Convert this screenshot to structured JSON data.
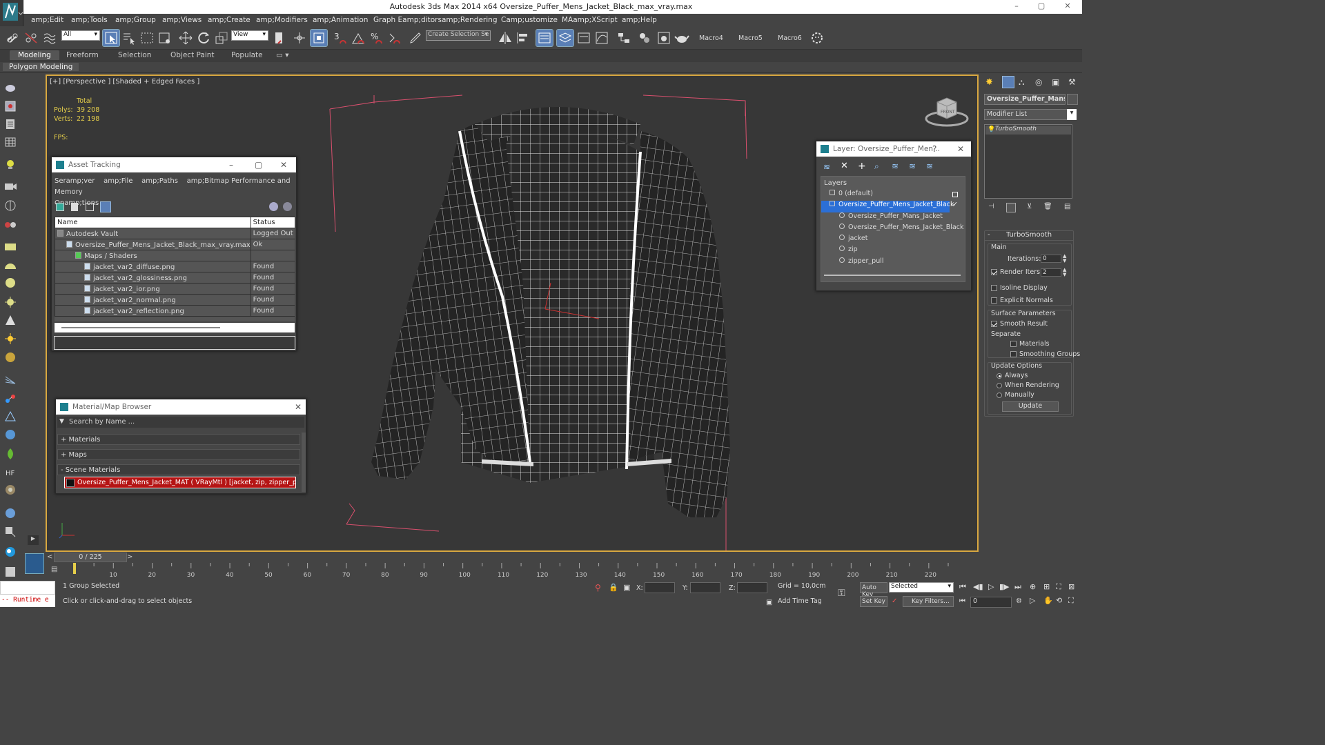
{
  "title_bar": {
    "title": "Autodesk 3ds Max  2014 x64      Oversize_Puffer_Mens_Jacket_Black_max_vray.max",
    "minimize": "–",
    "maximize": "▢",
    "close": "✕"
  },
  "menu": [
    "amp;Edit",
    "amp;Tools",
    "amp;Group",
    "amp;Views",
    "amp;Create",
    "amp;Modifiers",
    "amp;Animation",
    "Graph Eamp;ditors",
    "amp;Rendering",
    "Camp;ustomize",
    "MAamp;XScript",
    "amp;Help"
  ],
  "toolbar": {
    "selection_filter": "All",
    "ref_coord": "View",
    "named_selection_placeholder": "Create Selection Se",
    "snap_3": "3",
    "macros": [
      "Macro4",
      "Macro5",
      "Macro6"
    ]
  },
  "ribbon": {
    "tabs": [
      "Modeling",
      "Freeform",
      "Selection",
      "Object Paint",
      "Populate"
    ],
    "active_tab": "Modeling",
    "sub_panel": "Polygon Modeling"
  },
  "viewport": {
    "label": "[+] [Perspective ] [Shaded + Edged Faces ]",
    "stats": {
      "total_label": "Total",
      "polys_label": "Polys:",
      "polys_value": "39 208",
      "verts_label": "Verts:",
      "verts_value": "22 198",
      "fps_label": "FPS:"
    },
    "viewcube_label": "FRONT"
  },
  "asset_tracking": {
    "title": "Asset Tracking",
    "menu": [
      "Seramp;ver",
      "amp;File",
      "amp;Paths",
      "amp;Bitmap Performance and Memory"
    ],
    "menu2": "Opamp;tions",
    "columns": [
      "Name",
      "Status"
    ],
    "rows": [
      {
        "name": "Autodesk Vault",
        "status": "Logged Out ...",
        "indent": 1
      },
      {
        "name": "Oversize_Puffer_Mens_Jacket_Black_max_vray.max",
        "status": "Ok",
        "indent": 2
      },
      {
        "name": "Maps / Shaders",
        "status": "",
        "indent": 3
      },
      {
        "name": "jacket_var2_diffuse.png",
        "status": "Found",
        "indent": 4
      },
      {
        "name": "jacket_var2_glossiness.png",
        "status": "Found",
        "indent": 4
      },
      {
        "name": "jacket_var2_ior.png",
        "status": "Found",
        "indent": 4
      },
      {
        "name": "jacket_var2_normal.png",
        "status": "Found",
        "indent": 4
      },
      {
        "name": "jacket_var2_reflection.png",
        "status": "Found",
        "indent": 4
      }
    ]
  },
  "material_browser": {
    "title": "Material/Map Browser",
    "search_placeholder": "Search by Name ...",
    "sections": [
      "+ Materials",
      "+ Maps",
      "- Scene Materials"
    ],
    "scene_material": "Oversize_Puffer_Mens_Jacket_MAT  ( VRayMtl )  [jacket, zip, zipper_pull]"
  },
  "layer_dialog": {
    "title": "Layer: Oversize_Puffer_Men...",
    "help": "?",
    "header": "Layers",
    "items": [
      {
        "name": "0 (default)",
        "level": 0,
        "selected": false
      },
      {
        "name": "Oversize_Puffer_Mens_Jacket_Black",
        "level": 0,
        "selected": true
      },
      {
        "name": "Oversize_Puffer_Mans_Jacket",
        "level": 1,
        "selected": false
      },
      {
        "name": "Oversize_Puffer_Mens_Jacket_Black",
        "level": 1,
        "selected": false
      },
      {
        "name": "jacket",
        "level": 1,
        "selected": false
      },
      {
        "name": "zip",
        "level": 1,
        "selected": false
      },
      {
        "name": "zipper_pull",
        "level": 1,
        "selected": false
      }
    ]
  },
  "command_panel": {
    "object_name": "Oversize_Puffer_Mans_J",
    "modifier_list": "Modifier List",
    "stack_item": "TurboSmooth",
    "rollout_title": "TurboSmooth",
    "main_label": "Main",
    "iterations_label": "Iterations:",
    "iterations_value": "0",
    "render_iters_label": "Render Iters:",
    "render_iters_value": "2",
    "render_iters_checked": true,
    "isoline_label": "Isoline Display",
    "isoline_checked": false,
    "explicit_normals_label": "Explicit Normals",
    "explicit_normals_checked": false,
    "surface_params_label": "Surface Parameters",
    "smooth_result_label": "Smooth Result",
    "smooth_result_checked": true,
    "separate_label": "Separate",
    "materials_label": "Materials",
    "smoothing_groups_label": "Smoothing Groups",
    "update_options_label": "Update Options",
    "update_options": [
      "Always",
      "When Rendering",
      "Manually"
    ],
    "update_selected": "Always",
    "update_button": "Update"
  },
  "timeline": {
    "frame_counter": "0 / 225",
    "prev": "<",
    "next": ">",
    "current_frame": 0,
    "total_frames": 225,
    "ticks": [
      "0",
      "10",
      "20",
      "30",
      "40",
      "50",
      "60",
      "70",
      "80",
      "90",
      "100",
      "110",
      "120",
      "130",
      "140",
      "150",
      "160",
      "170",
      "180",
      "190",
      "200",
      "210",
      "220"
    ]
  },
  "status": {
    "maxscript_listener": "-- Runtime e",
    "selection_status": "1 Group Selected",
    "prompt": "Click or click-and-drag to select objects",
    "x_label": "X:",
    "y_label": "Y:",
    "z_label": "Z:",
    "grid": "Grid = 10,0cm",
    "add_time_tag": "Add Time Tag",
    "auto_key": "Auto Key",
    "set_key": "Set Key",
    "key_mode": "Selected",
    "key_filters": "Key Filters...",
    "frame_field": "0"
  },
  "colors": {
    "viewport_border": "#d9a840",
    "selection_blue": "#2b6fd6",
    "material_swatch_red": "#b51414",
    "stats_yellow": "#e6cf4a",
    "bbox_pink": "#d9506e"
  }
}
